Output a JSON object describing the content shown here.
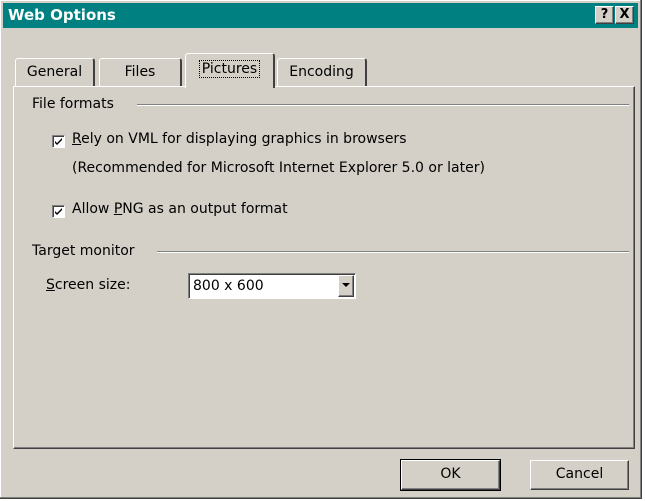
{
  "window": {
    "title": "Web Options",
    "help_label": "?",
    "close_label": "X"
  },
  "tabs": [
    {
      "label": "General",
      "active": false
    },
    {
      "label": "Files",
      "active": false
    },
    {
      "label": "Pictures",
      "active": true
    },
    {
      "label": "Encoding",
      "active": false
    }
  ],
  "file_formats": {
    "heading": "File formats",
    "vml": {
      "checked": true,
      "mnemonic": "R",
      "label_rest": "ely on VML for displaying graphics in browsers",
      "note": "(Recommended for Microsoft Internet Explorer 5.0 or later)"
    },
    "png": {
      "checked": true,
      "label_pre": "Allow ",
      "mnemonic": "P",
      "label_rest": "NG as an output format"
    }
  },
  "target_monitor": {
    "heading": "Target monitor",
    "screen_size": {
      "mnemonic": "S",
      "label_rest": "creen size:",
      "value": "800 x 600"
    }
  },
  "buttons": {
    "ok": "OK",
    "cancel": "Cancel"
  },
  "colors": {
    "titlebar": "#008080",
    "face": "#d4d0c8"
  }
}
